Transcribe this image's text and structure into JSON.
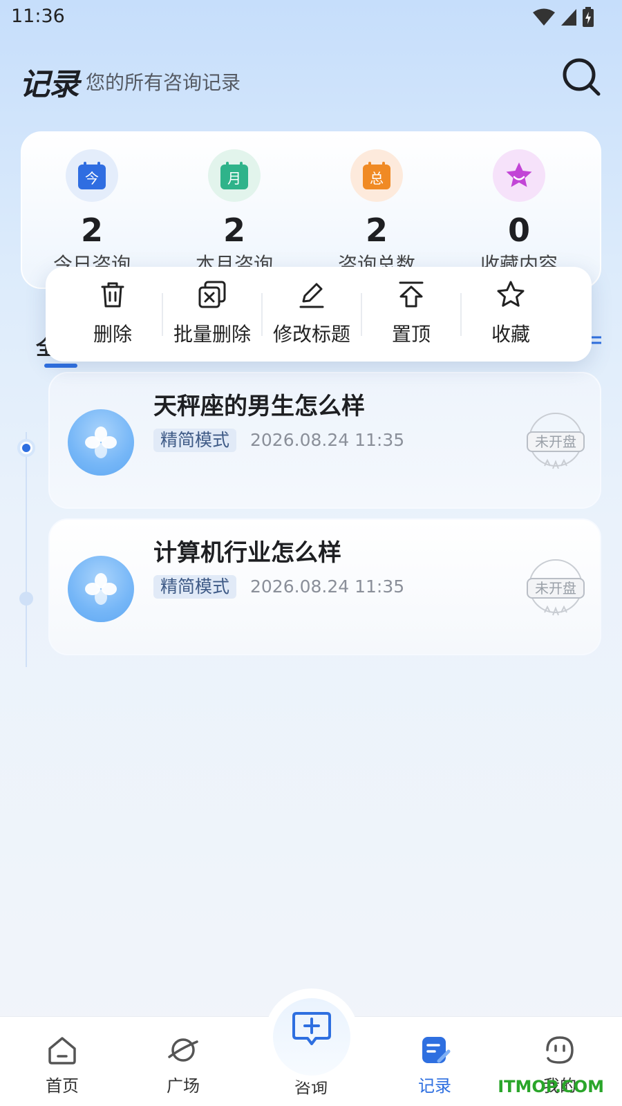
{
  "status_bar": {
    "time": "11:36",
    "icons": [
      "wifi-icon",
      "signal-icon",
      "battery-charging-icon"
    ]
  },
  "header": {
    "title": "记录",
    "subtitle": "您的所有咨询记录",
    "search_icon": "search-icon"
  },
  "stats": [
    {
      "value": "2",
      "label": "今日咨询",
      "icon": "calendar-today-icon",
      "icon_text": "今",
      "color": "#2f6de1"
    },
    {
      "value": "2",
      "label": "本月咨询",
      "icon": "calendar-month-icon",
      "icon_text": "月",
      "color": "#2fb38a"
    },
    {
      "value": "2",
      "label": "咨询总数",
      "icon": "calendar-total-icon",
      "icon_text": "总",
      "color": "#f08a24"
    },
    {
      "value": "0",
      "label": "收藏内容",
      "icon": "star-icon",
      "color": "#c245d6"
    }
  ],
  "tabs": {
    "partial_label": "全"
  },
  "context_menu": {
    "items": [
      {
        "label": "删除",
        "icon": "trash-icon"
      },
      {
        "label": "批量删除",
        "icon": "batch-delete-icon"
      },
      {
        "label": "修改标题",
        "icon": "edit-icon"
      },
      {
        "label": "置顶",
        "icon": "pin-top-icon"
      },
      {
        "label": "收藏",
        "icon": "star-outline-icon"
      }
    ]
  },
  "records": [
    {
      "title": "天秤座的男生怎么样",
      "mode": "精简模式",
      "time": "2026.08.24 11:35",
      "stamp": "未开盘"
    },
    {
      "title": "计算机行业怎么样",
      "mode": "精简模式",
      "time": "2026.08.24 11:35",
      "stamp": "未开盘"
    }
  ],
  "bottom_nav": {
    "items": [
      {
        "label": "首页",
        "icon": "home-icon",
        "active": false
      },
      {
        "label": "广场",
        "icon": "planet-icon",
        "active": false
      },
      {
        "label": "咨询",
        "icon": "consult-icon",
        "active": false
      },
      {
        "label": "记录",
        "icon": "records-icon",
        "active": true
      },
      {
        "label": "我的",
        "icon": "profile-icon",
        "active": false
      }
    ]
  },
  "watermark": "ITMOP.COM",
  "colors": {
    "accent": "#2e6fe0",
    "text": "#1e1f22",
    "muted": "#8a8f99"
  }
}
